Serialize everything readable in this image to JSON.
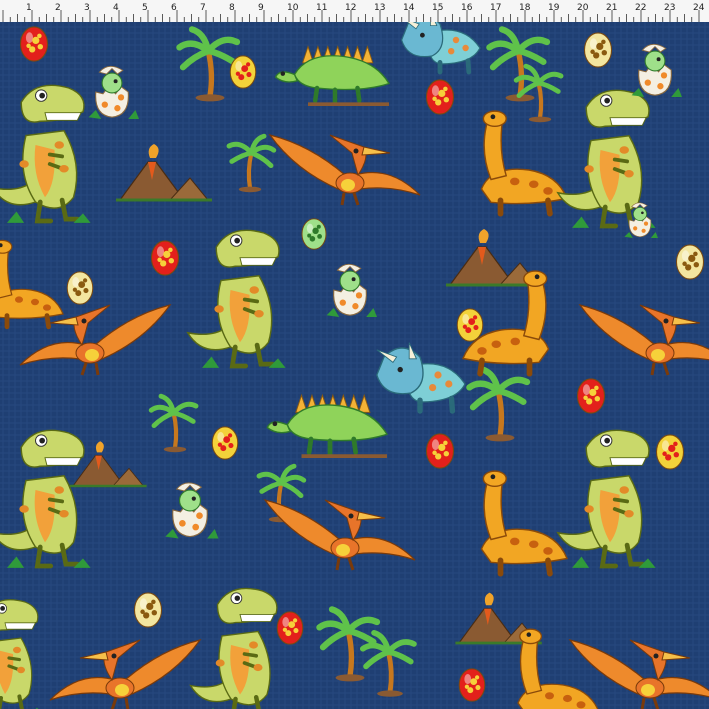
{
  "ruler": {
    "labels": [
      "1",
      "2",
      "3",
      "4",
      "5",
      "6",
      "7",
      "8",
      "9",
      "10",
      "11",
      "12",
      "13",
      "14",
      "15",
      "16",
      "17",
      "18",
      "19",
      "20",
      "21",
      "22",
      "23",
      "24"
    ]
  },
  "fabric": {
    "background_color": "#1f3f73",
    "motifs": [
      "t-rex",
      "pterodactyl",
      "stegosaurus",
      "brontosaurus",
      "triceratops",
      "hatching-egg",
      "spotted-egg",
      "volcano",
      "palm-tree"
    ],
    "colors": {
      "trex_body": "#c9d86a",
      "trex_belly": "#f2a13a",
      "ptero_wing": "#ee8a2c",
      "stego_body": "#8fd35a",
      "stego_plates": "#f3b236",
      "bronto_body": "#f2a623",
      "egg_red": "#e3201b",
      "egg_yellow": "#f3d23a",
      "egg_cream": "#f3e6a0",
      "egg_green": "#9fe08a",
      "volcano": "#8a5a32",
      "palm_leaf": "#5fc24a"
    }
  }
}
